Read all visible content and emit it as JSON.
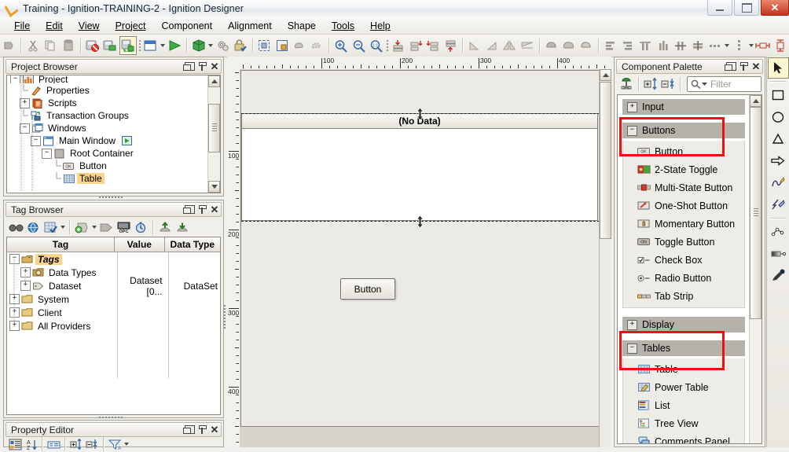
{
  "window": {
    "title": "Training - Ignition-TRAINING-2 - Ignition Designer",
    "minimize_label": "Minimize",
    "maximize_label": "Maximize",
    "close_label": "✕"
  },
  "menubar": [
    {
      "label": "File",
      "mnemonic": "F"
    },
    {
      "label": "Edit",
      "mnemonic": "E"
    },
    {
      "label": "View",
      "mnemonic": "V"
    },
    {
      "label": "Project",
      "mnemonic": "P"
    },
    {
      "label": "Component",
      "mnemonic": "C"
    },
    {
      "label": "Alignment",
      "mnemonic": "A"
    },
    {
      "label": "Shape",
      "mnemonic": "S"
    },
    {
      "label": "Tools",
      "mnemonic": "T"
    },
    {
      "label": "Help",
      "mnemonic": "H"
    }
  ],
  "toolbar": {
    "items": [
      {
        "name": "undo-icon",
        "label": "Undo"
      },
      {
        "name": "cut-icon",
        "label": "Cut"
      },
      {
        "name": "copy-icon",
        "label": "Copy"
      },
      {
        "name": "paste-icon",
        "label": "Paste"
      },
      {
        "name": "save-disabled-icon",
        "label": "Save (disabled)"
      },
      {
        "name": "publish-icon",
        "label": "Publish"
      },
      {
        "name": "update-project-icon",
        "label": "Update Project",
        "selected": true
      },
      {
        "name": "new-window-icon",
        "label": "New Window"
      },
      {
        "name": "preview-mode-icon",
        "label": "Preview Mode"
      },
      {
        "name": "launch-client-icon",
        "label": "Launch Client"
      },
      {
        "name": "gear-icon",
        "label": "Settings"
      },
      {
        "name": "lock-icon",
        "label": "Lock"
      },
      {
        "name": "select-all-icon",
        "label": "Select All"
      },
      {
        "name": "container-icon",
        "label": "Container"
      },
      {
        "name": "group-icon",
        "label": "Group"
      },
      {
        "name": "ungroup-icon",
        "label": "Ungroup"
      },
      {
        "name": "zoom-in-icon",
        "label": "Zoom In"
      },
      {
        "name": "zoom-out-icon",
        "label": "Zoom Out"
      },
      {
        "name": "zoom-reset-icon",
        "label": "Zoom 1:1"
      },
      {
        "name": "align-top-icon",
        "label": "Align Top"
      },
      {
        "name": "align-left-icon",
        "label": "Align Left"
      },
      {
        "name": "align-right-icon",
        "label": "Align Right"
      },
      {
        "name": "align-bottom-icon",
        "label": "Align Bottom"
      },
      {
        "name": "rotate-left-icon",
        "label": "Rotate Left"
      },
      {
        "name": "rotate-right-icon",
        "label": "Rotate Right"
      },
      {
        "name": "flip-horizontal-icon",
        "label": "Flip Horizontal"
      },
      {
        "name": "flip-vertical-icon",
        "label": "Flip Vertical"
      },
      {
        "name": "shape-union-icon",
        "label": "Union"
      },
      {
        "name": "shape-intersect-icon",
        "label": "Intersect"
      },
      {
        "name": "shape-subtract-icon",
        "label": "Subtract"
      },
      {
        "name": "justify-left-icon",
        "label": "Justify Left"
      },
      {
        "name": "justify-right-icon",
        "label": "Justify Right"
      },
      {
        "name": "distribute-top-icon",
        "label": "Distribute Top"
      },
      {
        "name": "distribute-bottom-icon",
        "label": "Distribute Bottom"
      },
      {
        "name": "center-vertical-icon",
        "label": "Center Vertically"
      },
      {
        "name": "center-horizontal-icon",
        "label": "Center Horizontally"
      },
      {
        "name": "space-horizontal-icon",
        "label": "Space Horizontally"
      },
      {
        "name": "space-vertical-icon",
        "label": "Space Vertically"
      },
      {
        "name": "size-width-icon",
        "label": "Match Width"
      },
      {
        "name": "size-height-icon",
        "label": "Match Height"
      }
    ]
  },
  "project_browser": {
    "title": "Project Browser",
    "nodes": [
      {
        "label": "Project",
        "depth": 0,
        "expander": "-",
        "icon": "project-icon",
        "selected": false,
        "clipped": true
      },
      {
        "label": "Properties",
        "depth": 1,
        "expander": "",
        "icon": "properties-icon",
        "selected": false
      },
      {
        "label": "Scripts",
        "depth": 1,
        "expander": "+",
        "icon": "scripts-icon",
        "selected": false
      },
      {
        "label": "Transaction Groups",
        "depth": 1,
        "expander": "",
        "icon": "transaction-groups-icon",
        "selected": false
      },
      {
        "label": "Windows",
        "depth": 1,
        "expander": "-",
        "icon": "windows-icon",
        "selected": false
      },
      {
        "label": "Main Window",
        "depth": 2,
        "expander": "-",
        "icon": "window-icon",
        "selected": false,
        "badge": "play-badge-icon"
      },
      {
        "label": "Root Container",
        "depth": 3,
        "expander": "-",
        "icon": "container-icon",
        "selected": false
      },
      {
        "label": "Button",
        "depth": 4,
        "expander": "",
        "icon": "button-component-icon",
        "selected": false
      },
      {
        "label": "Table",
        "depth": 4,
        "expander": "",
        "icon": "table-component-icon",
        "selected": true
      }
    ]
  },
  "tag_browser": {
    "title": "Tag Browser",
    "toolbar": [
      {
        "name": "find-tags-icon",
        "label": "Find Tags"
      },
      {
        "name": "tag-providers-icon",
        "label": "Tag Providers"
      },
      {
        "name": "tag-editor-icon",
        "label": "Tag Editor"
      },
      {
        "name": "add-tag-icon",
        "label": "Add Tag"
      },
      {
        "name": "tag-icon",
        "label": "Tag"
      },
      {
        "name": "opc-icon",
        "label": "OPC"
      },
      {
        "name": "tag-history-icon",
        "label": "Tag History"
      },
      {
        "name": "import-tags-icon",
        "label": "Import Tags"
      },
      {
        "name": "export-tags-icon",
        "label": "Export Tags"
      }
    ],
    "columns": [
      "Tag",
      "Value",
      "Data Type"
    ],
    "rows": [
      {
        "tag": "Tags",
        "value": "",
        "datatype": "",
        "depth": 0,
        "expander": "-",
        "icon": "tags-root-icon",
        "selected": true,
        "italic": true
      },
      {
        "tag": "Data Types",
        "value": "",
        "datatype": "",
        "depth": 1,
        "expander": "+",
        "icon": "data-types-icon",
        "selected": false,
        "italic": false
      },
      {
        "tag": "Dataset",
        "value": "Dataset [0...",
        "datatype": "DataSet",
        "depth": 1,
        "expander": "+",
        "icon": "dataset-tag-icon",
        "selected": false,
        "italic": false
      },
      {
        "tag": "System",
        "value": "",
        "datatype": "",
        "depth": 0,
        "expander": "+",
        "icon": "folder-icon",
        "selected": false,
        "italic": false
      },
      {
        "tag": "Client",
        "value": "",
        "datatype": "",
        "depth": 0,
        "expander": "+",
        "icon": "folder-icon",
        "selected": false,
        "italic": false
      },
      {
        "tag": "All Providers",
        "value": "",
        "datatype": "",
        "depth": 0,
        "expander": "+",
        "icon": "folder-icon",
        "selected": false,
        "italic": false
      }
    ]
  },
  "property_editor": {
    "title": "Property Editor",
    "toolbar": [
      {
        "name": "categorized-view-icon",
        "label": "Categorized"
      },
      {
        "name": "sort-alpha-icon",
        "label": "Sort Alphabetically"
      },
      {
        "name": "description-icon",
        "label": "Show Description"
      },
      {
        "name": "expand-all-icon",
        "label": "Expand All"
      },
      {
        "name": "collapse-all-icon",
        "label": "Collapse All"
      },
      {
        "name": "filter-icon",
        "label": "Filter"
      }
    ]
  },
  "design_area": {
    "ruler_h_labels": [
      100,
      200,
      300,
      400
    ],
    "ruler_v_labels": [
      100,
      200,
      300,
      400
    ],
    "table_header_text": "(No Data)",
    "button_text": "Button"
  },
  "component_palette": {
    "title": "Component Palette",
    "filter_placeholder": "Filter",
    "filter_value": "",
    "toolbar": [
      {
        "name": "palette-settings-icon",
        "label": "Palette Settings"
      },
      {
        "name": "expand-all-icon",
        "label": "Expand All"
      },
      {
        "name": "collapse-all-icon",
        "label": "Collapse All"
      }
    ],
    "groups": [
      {
        "label": "Input",
        "expander": "+",
        "expanded": false,
        "highlighted": false,
        "items": []
      },
      {
        "label": "Buttons",
        "expander": "-",
        "expanded": true,
        "highlighted": true,
        "items": [
          {
            "label": "Button",
            "icon": "button-component-icon",
            "highlighted": true
          },
          {
            "label": "2-State Toggle",
            "icon": "two-state-toggle-icon",
            "highlighted": false
          },
          {
            "label": "Multi-State Button",
            "icon": "multi-state-button-icon",
            "highlighted": false
          },
          {
            "label": "One-Shot Button",
            "icon": "one-shot-button-icon",
            "highlighted": false
          },
          {
            "label": "Momentary Button",
            "icon": "momentary-button-icon",
            "highlighted": false
          },
          {
            "label": "Toggle Button",
            "icon": "toggle-button-icon",
            "highlighted": false
          },
          {
            "label": "Check Box",
            "icon": "check-box-icon",
            "highlighted": false
          },
          {
            "label": "Radio Button",
            "icon": "radio-button-icon",
            "highlighted": false
          },
          {
            "label": "Tab Strip",
            "icon": "tab-strip-icon",
            "highlighted": false
          }
        ]
      },
      {
        "label": "Display",
        "expander": "+",
        "expanded": false,
        "highlighted": false,
        "items": []
      },
      {
        "label": "Tables",
        "expander": "-",
        "expanded": true,
        "highlighted": true,
        "items": [
          {
            "label": "Table",
            "icon": "table-component-icon",
            "highlighted": true
          },
          {
            "label": "Power Table",
            "icon": "power-table-icon",
            "highlighted": false
          },
          {
            "label": "List",
            "icon": "list-component-icon",
            "highlighted": false
          },
          {
            "label": "Tree View",
            "icon": "tree-view-icon",
            "highlighted": false
          },
          {
            "label": "Comments Panel",
            "icon": "comments-panel-icon",
            "highlighted": false
          }
        ]
      }
    ],
    "highlight_color": "#ee1111"
  },
  "shape_tools": [
    {
      "name": "select-arrow-tool-icon",
      "label": "Select",
      "selected": true
    },
    {
      "name": "rectangle-tool-icon",
      "label": "Rectangle",
      "selected": false
    },
    {
      "name": "ellipse-tool-icon",
      "label": "Ellipse",
      "selected": false
    },
    {
      "name": "triangle-tool-icon",
      "label": "Triangle",
      "selected": false
    },
    {
      "name": "arrow-shape-tool-icon",
      "label": "Arrow",
      "selected": false
    },
    {
      "name": "pen-tool-icon",
      "label": "Pen",
      "selected": false
    },
    {
      "name": "pencil-tool-icon",
      "label": "Pencil",
      "selected": false
    },
    {
      "name": "polyline-tool-icon",
      "label": "Polyline",
      "selected": false
    },
    {
      "name": "gradient-tool-icon",
      "label": "Gradient",
      "selected": false
    },
    {
      "name": "eyedropper-tool-icon",
      "label": "Eyedropper",
      "selected": false
    }
  ]
}
